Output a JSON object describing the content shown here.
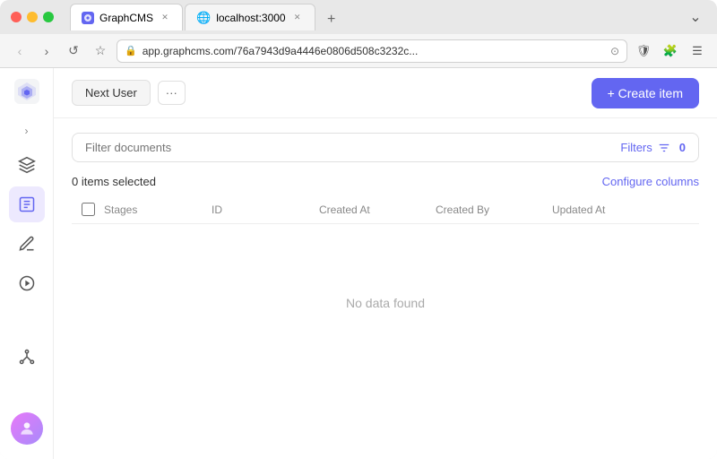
{
  "browser": {
    "tabs": [
      {
        "id": "tab1",
        "favicon": "G",
        "label": "GraphCMS",
        "active": false
      },
      {
        "id": "tab2",
        "favicon": "🌐",
        "label": "localhost:3000",
        "active": true
      }
    ],
    "address": "app.graphcms.com/76a7943d9a4446e0806d508c3232c...",
    "new_tab_label": "+"
  },
  "toolbar": {
    "breadcrumb_label": "Next User",
    "more_label": "···",
    "create_label": "+ Create item"
  },
  "filter": {
    "placeholder": "Filter documents",
    "filter_label": "Filters",
    "filter_count": "0"
  },
  "table": {
    "selection_label": "0 items selected",
    "configure_label": "Configure columns",
    "columns": [
      "Stages",
      "ID",
      "Created At",
      "Created By",
      "Updated At"
    ],
    "no_data_label": "No data found"
  },
  "sidebar": {
    "items": [
      {
        "id": "layers",
        "icon": "layers"
      },
      {
        "id": "edit",
        "icon": "edit"
      },
      {
        "id": "pen",
        "icon": "pen"
      },
      {
        "id": "play",
        "icon": "play"
      },
      {
        "id": "api",
        "icon": "api"
      }
    ],
    "collapse_icon": "›"
  }
}
